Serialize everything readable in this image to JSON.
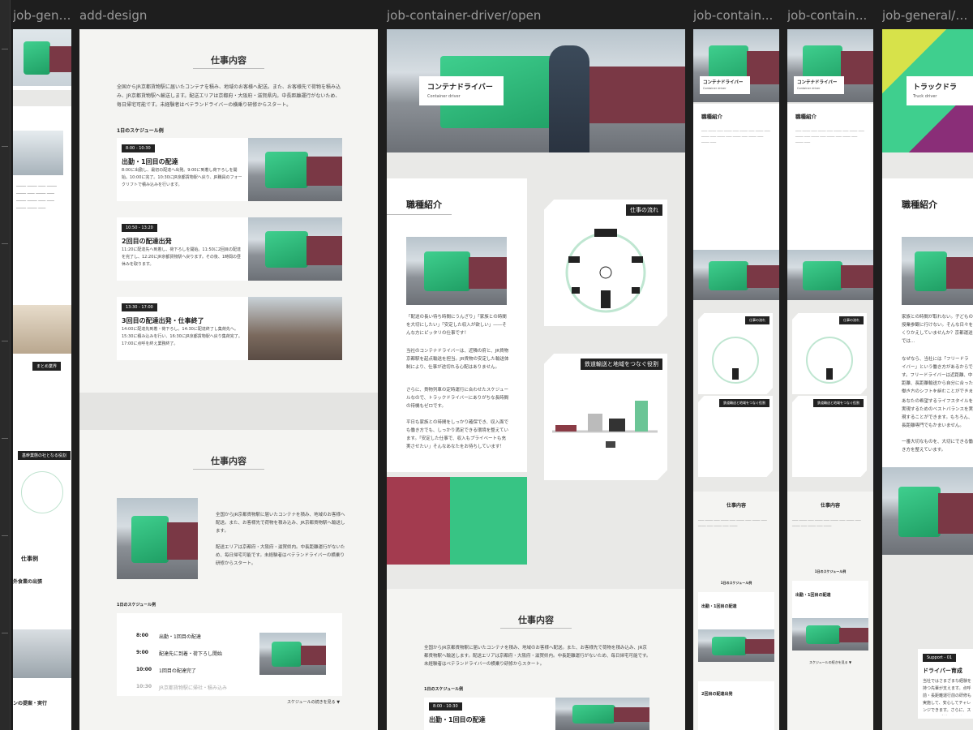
{
  "frames": [
    {
      "label": "job-general/..."
    },
    {
      "label": "add-design"
    },
    {
      "label": "job-container-driver/open"
    },
    {
      "label": "job-contain..."
    },
    {
      "label": "job-contain..."
    },
    {
      "label": "job-general/open"
    }
  ],
  "add_design": {
    "section_title": "仕事内容",
    "intro": "全国からJR京都貨物駅に届いたコンテナを積み、地域のお客様へ配送。また、お客様先で荷物を積み込み、JR京都貨物駅へ輸送します。配送エリアは京都府・大阪府・滋賀県内。中長距離運行がないため、毎日帰宅可能です。未経験者はベテランドライバーの横乗り研修からスタート。",
    "schedule_heading": "1日のスケジュール例",
    "schedule_cards": [
      {
        "time": "8:00 - 10:30",
        "title": "出勤・1回目の配達",
        "body": "8:00に出勤し、最初の配達へ出発。9:00に到着し荷下ろしを開始。10:00に完了。10:30にJR京都貨物駅へ戻り、JR職員のフォークリフトで積み込みを行います。"
      },
      {
        "time": "10:50 - 13:20",
        "title": "2回目の配達出発",
        "body": "11:20に配達先へ到着し、荷下ろしを開始。11:50に2回目の配達を完了し、12:20にJR京都貨物駅へ戻ります。その後、1時間の昼休みを取ります。"
      },
      {
        "time": "13:30 - 17:00",
        "title": "3回目の配達出発・仕事終了",
        "body": "14:00に配達先到着・荷下ろし。14:30に配達終了し集荷先へ。15:30に積み込みを行い、16:30にJR京都貨物駅へ戻り集荷完了。17:00に点呼を終え業務終了。"
      }
    ],
    "section_title_2": "仕事内容",
    "intro_2a": "全国からJR京都貨物駅に届いたコンテナを積み、地域のお客様へ配送。また、お客様先で荷物を積み込み、JR京都貨物駅へ輸送します。",
    "intro_2b": "配送エリアは京都府・大阪府・滋賀県内。中長距離運行がないため、毎日帰宅可能です。未経験者はベテランドライバーの横乗り研修からスタート。",
    "schedule_heading_2": "1日のスケジュール例",
    "timeline": [
      {
        "time": "8:00",
        "label": "出勤・1回目の配達"
      },
      {
        "time": "9:00",
        "label": "配達先に到着・荷下ろし開始"
      },
      {
        "time": "10:00",
        "label": "1回目の配達完了"
      },
      {
        "time": "10:30",
        "label": "JR京都貨物駅に帰社・積み込み"
      }
    ],
    "more_link": "スケジュールの続きを見る ▼"
  },
  "container_driver": {
    "hero_title": "コンテナドライバー",
    "hero_sub": "Container driver",
    "job_intro_title": "職種紹介",
    "job_intro_p1": "「配送の長い待ち時間にうんざり」「家族との時間を大切にしたい」「安定した収入が欲しい」――そんな方にピッタリの仕事です！",
    "job_intro_p2": "当社のコンテナドライバーは、近隣の府と、JR貨物京都駅を起点輸送を担当。JR貨物の安定した輸送体制により、仕事が途切れる心配はありません。",
    "job_intro_p3": "さらに、貨物列車の定時運行に合わせたスケジュールなので、トラックドライバーにありがちな長時間の待機もゼロです。",
    "job_intro_p4": "平日も家族との時間をしっかり確保でき、収入面でも働き方でも、しっかり満足できる環境を整えています。「安定した仕事で、収入もプライベートも充実させたい」そんなあなたをお待ちしています！",
    "flow_tag": "仕事の流れ",
    "rail_tag": "鉄道輸送と地域をつなぐ役割",
    "work_title": "仕事内容",
    "work_body": "全国からJR京都貨物駅に届いたコンテナを積み、地域のお客様へ配送。また、お客様先で荷物を積み込み、JR京都貨物駅へ輸送します。配送エリアは京都府・大阪府・滋賀県内。中長距離運行がないため、毎日帰宅可能です。未経験者はベテランドライバーの横乗り研修からスタート。",
    "schedule_heading": "1日のスケジュール例",
    "card_time": "8:00 - 10:30",
    "card_title": "出勤・1回目の配達"
  },
  "narrow": {
    "hero_title": "コンテナドライバー",
    "hero_sub": "Container driver",
    "job_intro_title": "職種紹介",
    "flow_tag": "仕事の流れ",
    "rail_tag": "鉄道輸送と地域をつなぐ役割",
    "work_title": "仕事内容",
    "schedule_heading": "1日のスケジュール例",
    "card_title": "出勤・1回目の配達",
    "card_title_2": "2回目の配達出発",
    "more_link": "スケジュールの続きを見る ▼"
  },
  "general": {
    "hero_title": "トラックドラ",
    "hero_sub": "Truck driver",
    "job_intro_title": "職種紹介",
    "p1": "家族との時間が取れない。子どもの授業参観に行けない。そんな日々をくりかえしていませんか？京都運送では…",
    "p2": "なぜなら、当社には「フリードライバー」という働き方があるからです。フリードライバーは近距離、中距離、長距離輸送から自分に合った働き方のシフトを組むことができます。",
    "p3": "あなたの希望するライフスタイルを実現するためのベストバランスを実現することができます。もちろん、長距離専門でもかまいません。",
    "p4": "一番大切なものを、大切にできる働き方を整えています。",
    "support_tag": "Support - 01",
    "support_title": "ドライバー育成",
    "support_body": "当社ではさまざまな経験を持つ先輩が支えます。点呼前・長距離運行前の研修も実施して、安心してチャレンジできます。さらに、スキルアップができます。"
  },
  "left_partial": {
    "label1": "まとめ業界",
    "label2": "基幹業態の社となる役割",
    "label3": "仕事例",
    "label4": "外食業の出張",
    "label5": "ンの提案・実行"
  }
}
